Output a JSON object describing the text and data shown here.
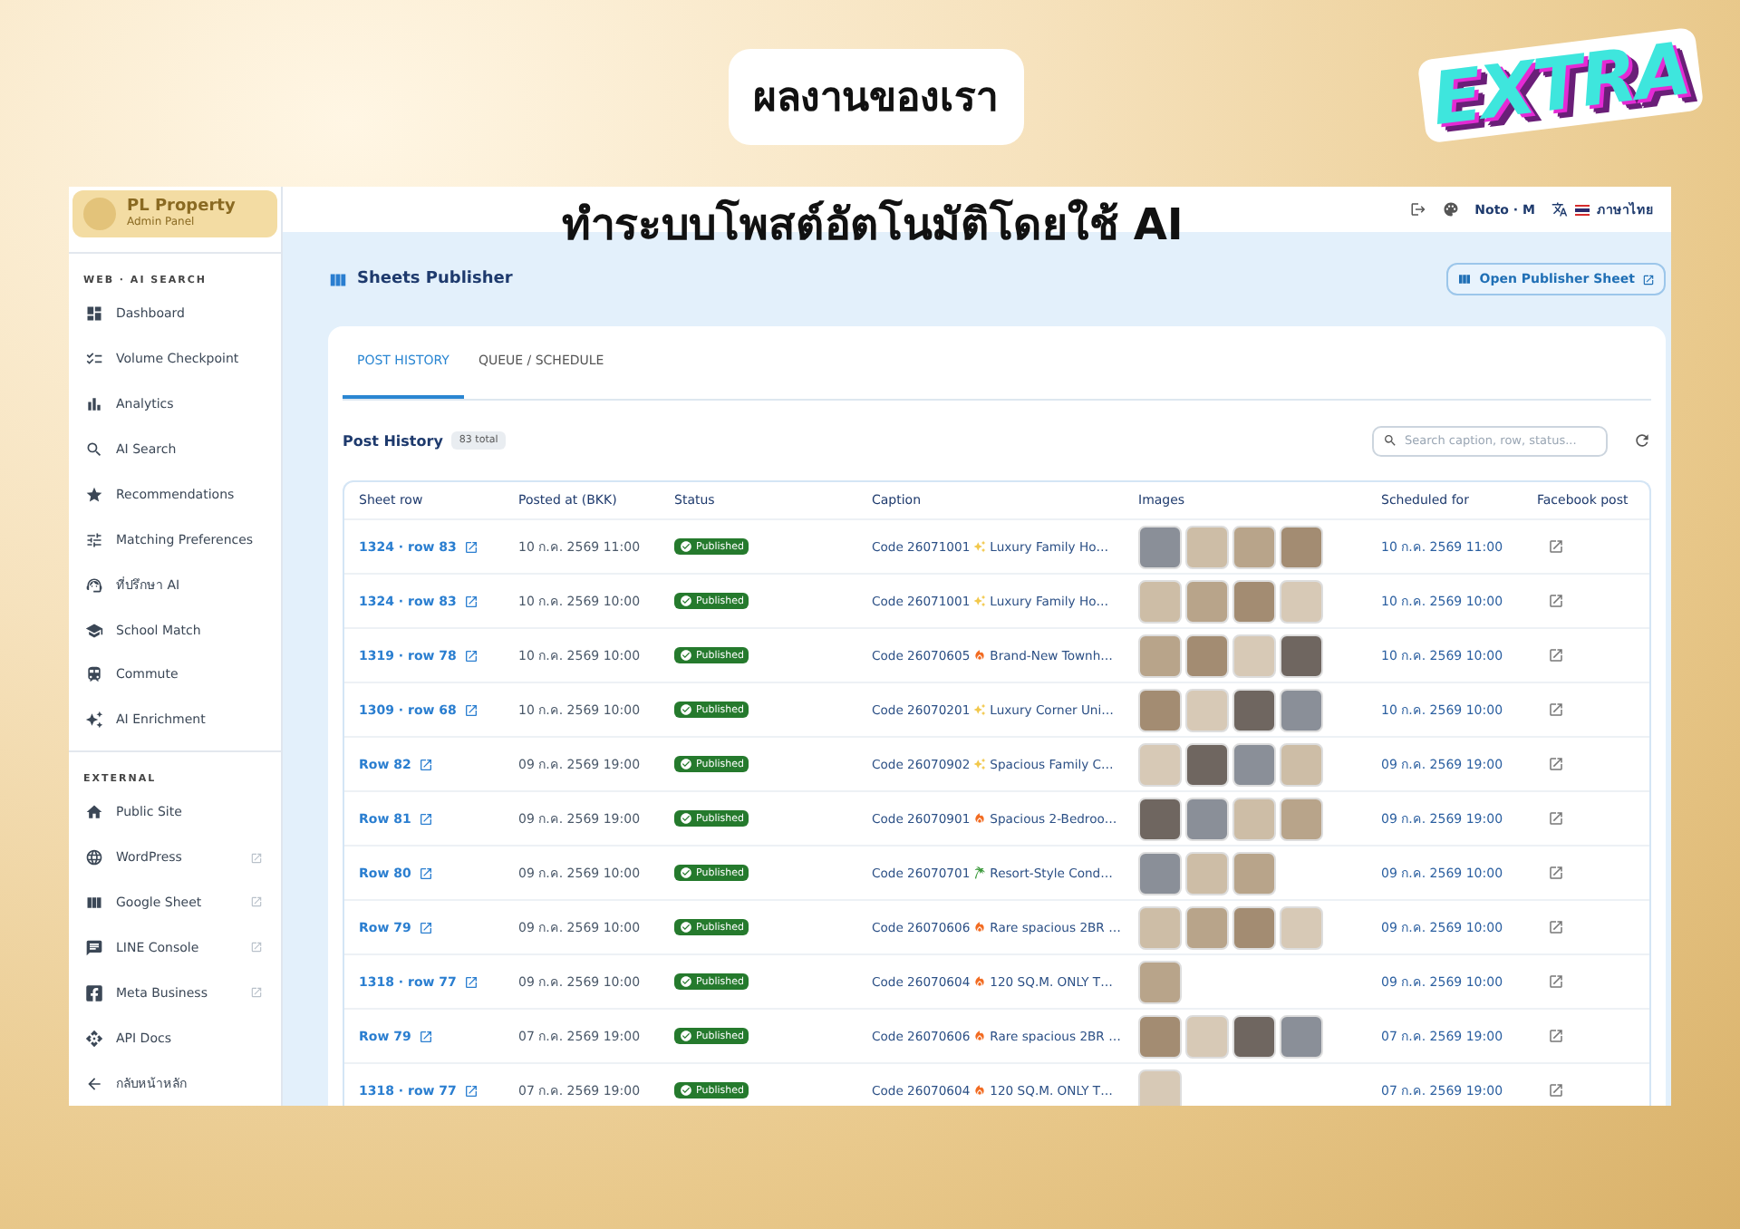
{
  "banner": {
    "badge": "ผลงานของเรา",
    "logo": "EXTRA",
    "headline": "ทำระบบโพสต์อัตโนมัติโดยใช้ AI"
  },
  "sidebar": {
    "brand": {
      "name": "PL Property",
      "subtitle": "Admin Panel"
    },
    "sections": [
      {
        "title": "WEB · AI SEARCH",
        "items": [
          {
            "label": "Dashboard",
            "external": false
          },
          {
            "label": "Volume Checkpoint",
            "external": false
          },
          {
            "label": "Analytics",
            "external": false
          },
          {
            "label": "AI Search",
            "external": false
          },
          {
            "label": "Recommendations",
            "external": false
          },
          {
            "label": "Matching Preferences",
            "external": false
          },
          {
            "label": "ที่ปรึกษา AI",
            "external": false
          },
          {
            "label": "School Match",
            "external": false
          },
          {
            "label": "Commute",
            "external": false
          },
          {
            "label": "AI Enrichment",
            "external": false
          }
        ]
      },
      {
        "title": "EXTERNAL",
        "items": [
          {
            "label": "Public Site",
            "external": false
          },
          {
            "label": "WordPress",
            "external": true
          },
          {
            "label": "Google Sheet",
            "external": true
          },
          {
            "label": "LINE Console",
            "external": true
          },
          {
            "label": "Meta Business",
            "external": true
          },
          {
            "label": "API Docs",
            "external": false
          },
          {
            "label": "กลับหน้าหลัก",
            "external": false
          }
        ]
      }
    ]
  },
  "topbar": {
    "font": "Noto · M",
    "language": "ภาษาไทย"
  },
  "page": {
    "title": "Sheets Publisher",
    "action": "Open Publisher Sheet"
  },
  "tabs": [
    {
      "label": "POST HISTORY",
      "selected": true
    },
    {
      "label": "QUEUE / SCHEDULE",
      "selected": false
    }
  ],
  "history": {
    "title": "Post History",
    "count": "83 total",
    "search_placeholder": "Search caption, row, status..."
  },
  "table": {
    "columns": [
      "Sheet row",
      "Posted at (BKK)",
      "Status",
      "Caption",
      "Images",
      "Scheduled for",
      "Facebook post"
    ],
    "rows": [
      {
        "sheet_row": "1324 · row 83",
        "posted": "10 ก.ค. 2569 11:00",
        "status": "Published",
        "code": "Code 26071001",
        "kind": "sparkle",
        "title": "Luxury Family Ho…",
        "images": [
          {
            "kind": "photo"
          },
          {
            "kind": "photo"
          },
          {
            "kind": "photo"
          },
          {
            "kind": "photo"
          }
        ],
        "scheduled": "10 ก.ค. 2569 11:00"
      },
      {
        "sheet_row": "1324 · row 83",
        "posted": "10 ก.ค. 2569 10:00",
        "status": "Published",
        "code": "Code 26071001",
        "kind": "sparkle",
        "title": "Luxury Family Ho…",
        "images": [
          {
            "kind": "photo"
          },
          {
            "kind": "photo"
          },
          {
            "kind": "photo"
          },
          {
            "kind": "photo"
          }
        ],
        "scheduled": "10 ก.ค. 2569 10:00"
      },
      {
        "sheet_row": "1319 · row 78",
        "posted": "10 ก.ค. 2569 10:00",
        "status": "Published",
        "code": "Code 26070605",
        "kind": "fire",
        "title": "Brand-New Townh…",
        "images": [
          {
            "kind": "photo"
          },
          {
            "kind": "photo"
          },
          {
            "kind": "photo"
          },
          {
            "kind": "photo"
          }
        ],
        "scheduled": "10 ก.ค. 2569 10:00"
      },
      {
        "sheet_row": "1309 · row 68",
        "posted": "10 ก.ค. 2569 10:00",
        "status": "Published",
        "code": "Code 26070201",
        "kind": "sparkle",
        "title": "Luxury Corner Uni…",
        "images": [
          {
            "kind": "photo"
          },
          {
            "kind": "photo"
          },
          {
            "kind": "photo"
          },
          {
            "kind": "photo"
          }
        ],
        "scheduled": "10 ก.ค. 2569 10:00"
      },
      {
        "sheet_row": "Row 82",
        "posted": "09 ก.ค. 2569 19:00",
        "status": "Published",
        "code": "Code 26070902",
        "kind": "sparkle",
        "title": "Spacious Family C…",
        "images": [
          {
            "kind": "photo"
          },
          {
            "kind": "photo"
          },
          {
            "kind": "photo"
          },
          {
            "kind": "photo"
          }
        ],
        "scheduled": "09 ก.ค. 2569 19:00"
      },
      {
        "sheet_row": "Row 81",
        "posted": "09 ก.ค. 2569 19:00",
        "status": "Published",
        "code": "Code 26070901",
        "kind": "fire",
        "title": "Spacious 2-Bedroo…",
        "images": [
          {
            "kind": "photo"
          },
          {
            "kind": "photo"
          },
          {
            "kind": "photo"
          },
          {
            "kind": "photo"
          }
        ],
        "scheduled": "09 ก.ค. 2569 19:00"
      },
      {
        "sheet_row": "Row 80",
        "posted": "09 ก.ค. 2569 10:00",
        "status": "Published",
        "code": "Code 26070701",
        "kind": "palm",
        "title": "Resort-Style Cond…",
        "images": [
          {
            "kind": "photo"
          },
          {
            "kind": "photo"
          },
          {
            "kind": "photo"
          }
        ],
        "scheduled": "09 ก.ค. 2569 10:00"
      },
      {
        "sheet_row": "Row 79",
        "posted": "09 ก.ค. 2569 10:00",
        "status": "Published",
        "code": "Code 26070606",
        "kind": "fire",
        "title": "Rare spacious 2BR …",
        "images": [
          {
            "kind": "photo"
          },
          {
            "kind": "photo"
          },
          {
            "kind": "photo"
          },
          {
            "kind": "photo"
          }
        ],
        "scheduled": "09 ก.ค. 2569 10:00"
      },
      {
        "sheet_row": "1318 · row 77",
        "posted": "09 ก.ค. 2569 10:00",
        "status": "Published",
        "code": "Code 26070604",
        "kind": "fire",
        "title": "120 SQ.M. ONLY T…",
        "images": [
          {
            "kind": "photo"
          }
        ],
        "scheduled": "09 ก.ค. 2569 10:00"
      },
      {
        "sheet_row": "Row 79",
        "posted": "07 ก.ค. 2569 19:00",
        "status": "Published",
        "code": "Code 26070606",
        "kind": "fire",
        "title": "Rare spacious 2BR …",
        "images": [
          {
            "kind": "photo"
          },
          {
            "kind": "photo"
          },
          {
            "kind": "photo"
          },
          {
            "kind": "photo"
          }
        ],
        "scheduled": "07 ก.ค. 2569 19:00"
      },
      {
        "sheet_row": "1318 · row 77",
        "posted": "07 ก.ค. 2569 19:00",
        "status": "Published",
        "code": "Code 26070604",
        "kind": "fire",
        "title": "120 SQ.M. ONLY T…",
        "images": [
          {
            "kind": "photo"
          }
        ],
        "scheduled": "07 ก.ค. 2569 19:00"
      }
    ]
  }
}
